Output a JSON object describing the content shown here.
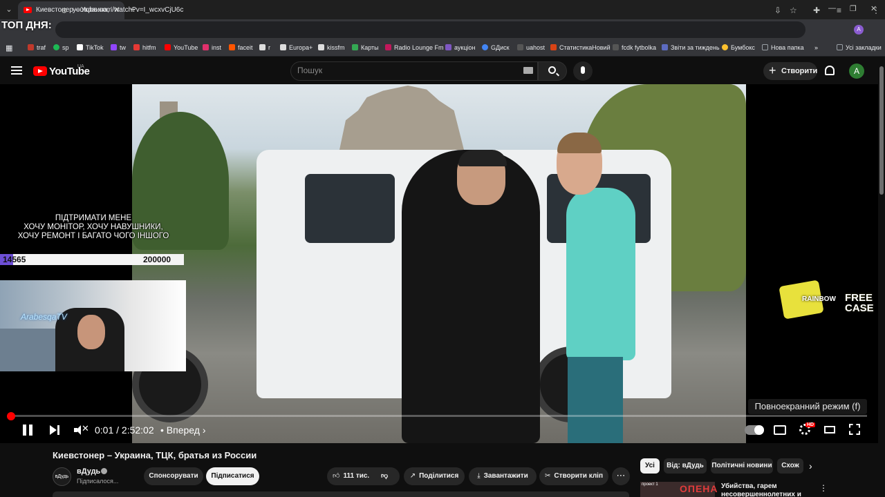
{
  "browser": {
    "tab_title": "Киевстонер – Украина, ТЦК, бр",
    "url": "youtube.com/watch?v=I_wcxvCjU6c",
    "profile_initial": "A",
    "bookmarks": [
      {
        "label": "traf",
        "color": "#c0392b"
      },
      {
        "label": "sp",
        "color": "#1db954"
      },
      {
        "label": "TikTok",
        "color": "#ffffff"
      },
      {
        "label": "tw",
        "color": "#9146ff"
      },
      {
        "label": "hitfm",
        "color": "#e53935"
      },
      {
        "label": "YouTube",
        "color": "#ff0000"
      },
      {
        "label": "inst",
        "color": "#e1306c"
      },
      {
        "label": "faceit",
        "color": "#ff5500"
      },
      {
        "label": "r",
        "color": "#dddddd"
      },
      {
        "label": "Europa+",
        "color": "#dddddd"
      },
      {
        "label": "kissfm",
        "color": "#dddddd"
      },
      {
        "label": "Карты",
        "color": "#34a853"
      },
      {
        "label": "Radio Lounge Fm",
        "color": "#c2185b"
      },
      {
        "label": "аукціон",
        "color": "#7e57c2"
      },
      {
        "label": "GДиск",
        "color": "#4285f4"
      },
      {
        "label": "uahost",
        "color": "#555555"
      },
      {
        "label": "СтатистикаНовий",
        "color": "#d84315"
      },
      {
        "label": "fcdk fytbolka",
        "color": "#555555"
      },
      {
        "label": "Звіти за тиждень",
        "color": "#5c6bc0"
      },
      {
        "label": "Бумбокс",
        "color": "#fbc02d"
      },
      {
        "label": "Нова папка",
        "color": "#9aa0a6"
      }
    ],
    "all_bookmarks": "Усі закладки"
  },
  "overlay": {
    "top_day": "ТОП ДНЯ:",
    "donate_text": "ПІДТРИМАТИ МЕНЕ\nХОЧУ МОНІТОР, ХОЧУ НАВУШНИКИ,\nХОЧУ РЕМОНТ І БАГАТО ЧОГО ІНШОГО",
    "goal_current": "14565",
    "goal_target": "200000",
    "goal_fraction": 0.07,
    "cam_tag": "ArabesqaTV",
    "case_logo": "FREE\nCASE",
    "case_logo_small": "RAINBOW"
  },
  "youtube": {
    "logo_text": "YouTube",
    "region": "UA",
    "search_placeholder": "Пошук",
    "create_label": "Створити",
    "avatar_initial": "A"
  },
  "player": {
    "tooltip": "Повноекранний режим (f)",
    "time": "0:01 / 2:52:02",
    "chapter": "• Вперед ›",
    "progress_fraction": 0.0001,
    "hd_label": "HD"
  },
  "video": {
    "title": "Киевстонер – Украина, ТЦК, братья из России",
    "channel_name": "вДудь",
    "channel_avatar": "вДудь",
    "channel_status": "Підписалося...",
    "sponsor_label": "Спонсорувати",
    "subscribe_label": "Підписатися",
    "likes": "111 тис.",
    "share_label": "Поділитися",
    "download_label": "Завантажити",
    "clip_label": "Створити кліп",
    "more_label": "⋯"
  },
  "sidebar": {
    "chips": [
      "Усі",
      "Від: вДудь",
      "Політичні новини",
      "Схож"
    ],
    "rec_title": "Убийства, гарем несовершеннолетних и тайны",
    "rec_thumb_tag": "проект 1",
    "rec_thumb_big": "ОПЕНА"
  }
}
